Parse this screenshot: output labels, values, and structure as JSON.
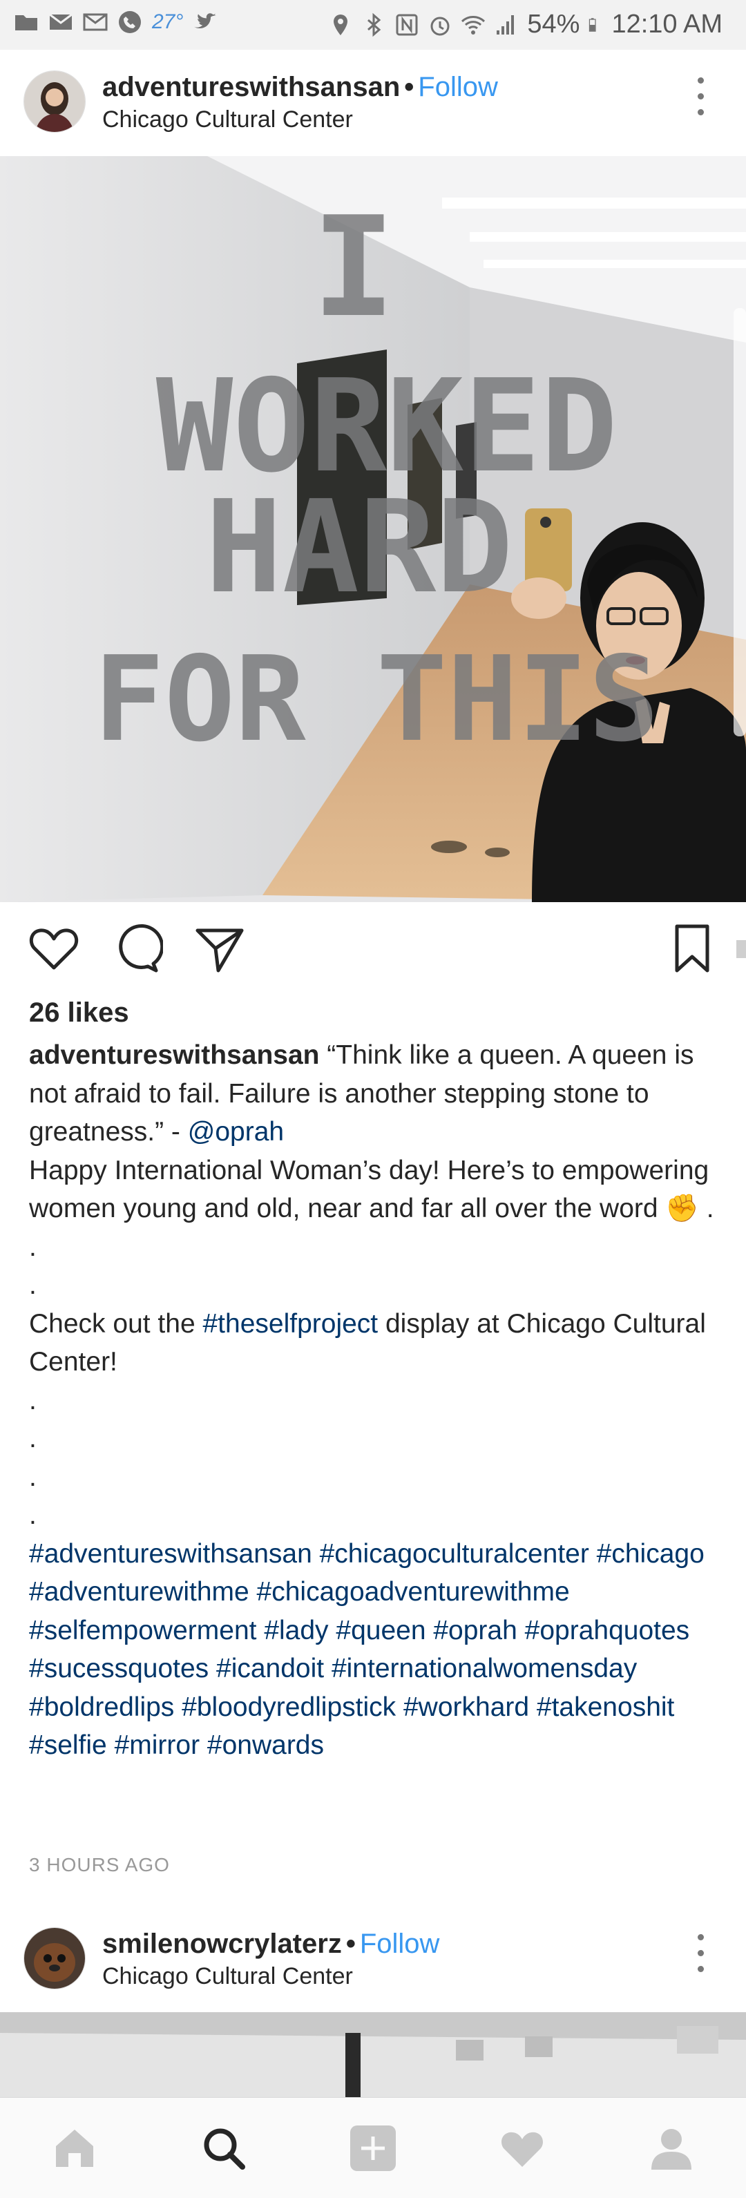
{
  "status_bar": {
    "temperature": "27°",
    "battery": "54%",
    "time": "12:10 AM"
  },
  "post1": {
    "username": "adventureswithsansan",
    "follow_label": "Follow",
    "location": "Chicago Cultural Center",
    "photo_text": [
      "I",
      "WORKED",
      "HARD",
      "FOR THIS"
    ],
    "likes": "26 likes",
    "caption_user": "adventureswithsansan",
    "caption_quote": " “Think like a queen. A queen is not afraid to fail. Failure is another stepping stone to greatness.” - ",
    "caption_mention": "@oprah",
    "caption_line2": "Happy International Woman’s day! Here’s to empowering women young and old, near and far all over the word ✊ .",
    "dots": [
      ".",
      ".",
      ".",
      ".",
      ".",
      "."
    ],
    "check_prefix": "Check out the ",
    "check_tag": "#theselfproject",
    "check_suffix": " display at Chicago Cultural Center!",
    "hashtags": "#adventureswithsansan #chicagoculturalcenter #chicago #adventurewithme #chicagoadventurewithme #selfempowerment #lady #queen #oprah #oprahquotes #sucessquotes #icandoit #internationalwomensday #boldredlips #bloodyredlipstick #workhard #takenoshit #selfie #mirror #onwards",
    "time_ago": "3 HOURS AGO"
  },
  "post2": {
    "username": "smilenowcrylaterz",
    "follow_label": "Follow",
    "location": "Chicago Cultural Center"
  },
  "colors": {
    "link": "#3897f0",
    "hashtag": "#003569",
    "status_bg": "#f2f2f2"
  },
  "icons": {
    "nav": [
      "home-icon",
      "search-icon",
      "add-icon",
      "heart-icon",
      "profile-icon"
    ],
    "actions": [
      "like-icon",
      "comment-icon",
      "share-icon",
      "save-icon"
    ]
  }
}
